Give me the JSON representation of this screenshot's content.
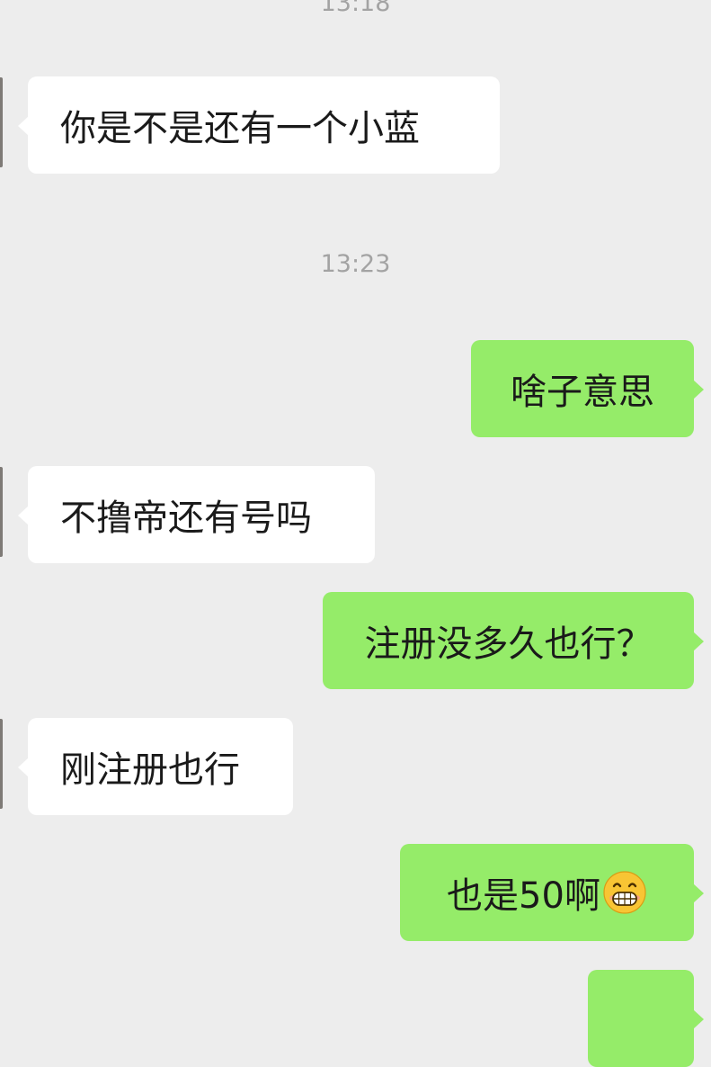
{
  "messages": [
    {
      "id": "ts1",
      "type": "timestamp",
      "text": "13:18"
    },
    {
      "id": "m1",
      "type": "incoming",
      "text": "你是不是还有一个小蓝"
    },
    {
      "id": "ts2",
      "type": "timestamp",
      "text": "13:23"
    },
    {
      "id": "m2",
      "type": "outgoing",
      "text": "啥子意思"
    },
    {
      "id": "m3",
      "type": "incoming",
      "text": "不撸帝还有号吗"
    },
    {
      "id": "m4",
      "type": "outgoing",
      "text": "注册没多久也行？"
    },
    {
      "id": "m5",
      "type": "incoming",
      "text": "刚注册也行"
    },
    {
      "id": "m6",
      "type": "outgoing",
      "text": "也是50啊",
      "emoji": "grinning-face-emoji"
    },
    {
      "id": "m7",
      "type": "outgoing",
      "text": ""
    }
  ],
  "colors": {
    "background": "#ededed",
    "incoming_bubble": "#ffffff",
    "outgoing_bubble": "#95ec69",
    "timestamp": "#a3a3a3",
    "text": "#1a1a1a"
  }
}
